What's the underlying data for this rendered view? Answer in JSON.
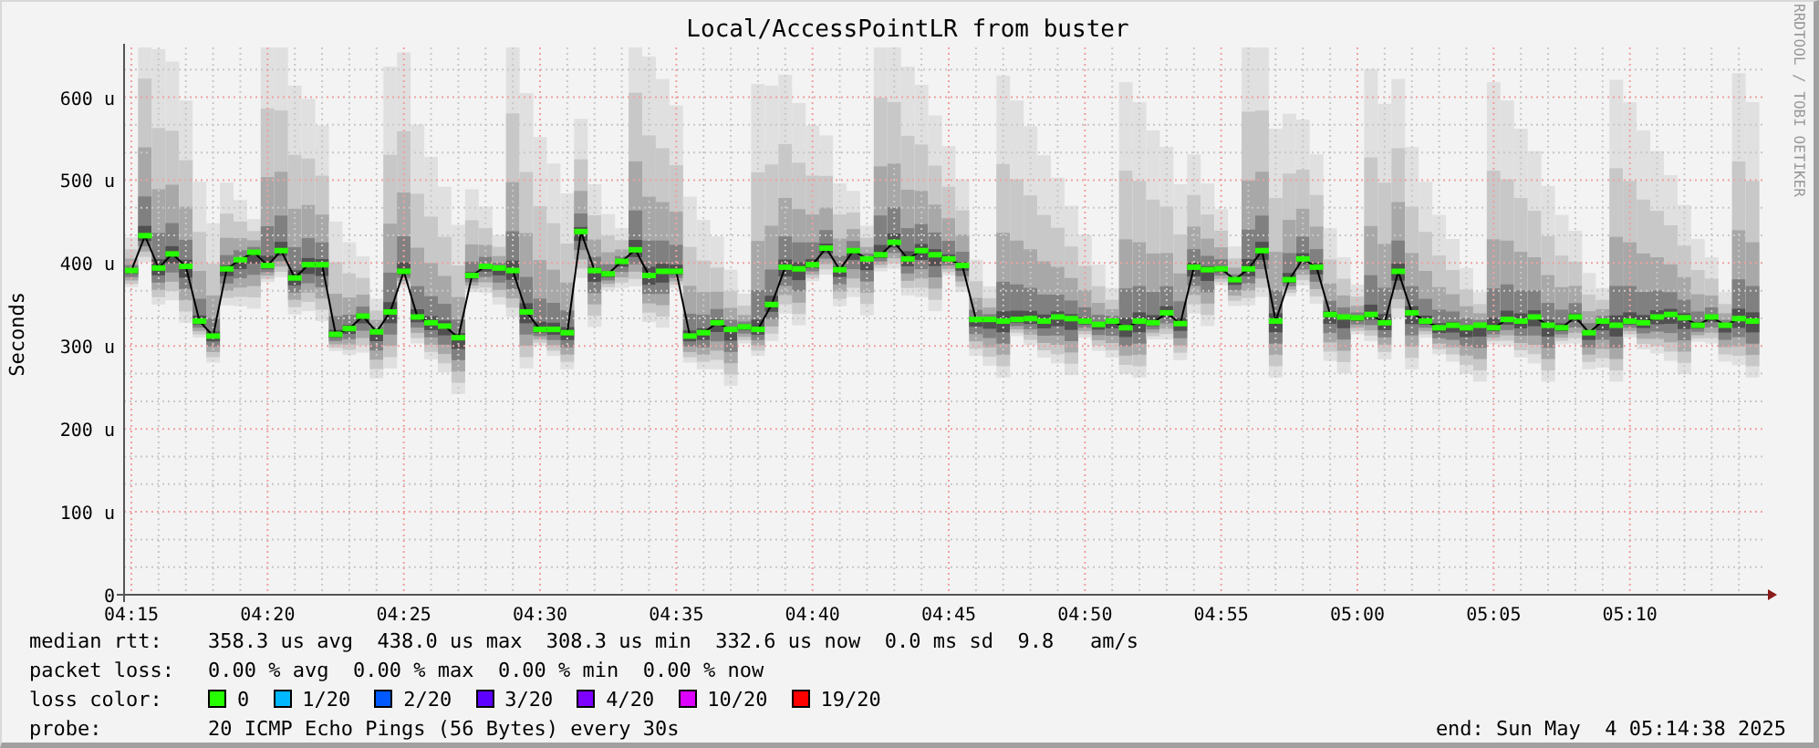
{
  "graph": {
    "title": "Local/AccessPointLR from buster",
    "credit": "RRDTOOL / TOBI OETIKER",
    "chart_data": {
      "type": "line",
      "grid": true,
      "ylabel": "Seconds",
      "ylim": [
        0,
        660
      ],
      "categories": [
        "04:15",
        null,
        null,
        null,
        null,
        null,
        null,
        null,
        null,
        null,
        "04:20",
        null,
        null,
        null,
        null,
        null,
        null,
        null,
        null,
        null,
        "04:25",
        null,
        null,
        null,
        null,
        null,
        null,
        null,
        null,
        null,
        "04:30",
        null,
        null,
        null,
        null,
        null,
        null,
        null,
        null,
        null,
        "04:35",
        null,
        null,
        null,
        null,
        null,
        null,
        null,
        null,
        null,
        "04:40",
        null,
        null,
        null,
        null,
        null,
        null,
        null,
        null,
        null,
        "04:45",
        null,
        null,
        null,
        null,
        null,
        null,
        null,
        null,
        null,
        "04:50",
        null,
        null,
        null,
        null,
        null,
        null,
        null,
        null,
        null,
        "04:55",
        null,
        null,
        null,
        null,
        null,
        null,
        null,
        null,
        null,
        "05:00",
        null,
        null,
        null,
        null,
        null,
        null,
        null,
        null,
        null,
        "05:05",
        null,
        null,
        null,
        null,
        null,
        null,
        null,
        null,
        null,
        "05:10",
        null,
        null,
        null,
        null,
        null,
        null,
        null,
        null,
        null
      ],
      "yticks": [
        {
          "value": 0,
          "label": "0"
        },
        {
          "value": 100,
          "label": "100 u"
        },
        {
          "value": 200,
          "label": "200 u"
        },
        {
          "value": 300,
          "label": "300 u"
        },
        {
          "value": 400,
          "label": "400 u"
        },
        {
          "value": 500,
          "label": "500 u"
        },
        {
          "value": 600,
          "label": "600 u"
        }
      ],
      "series": [
        {
          "name": "median rtt:",
          "color": "#26ff00",
          "marker": "square",
          "values": [
            391,
            433,
            394,
            411,
            396,
            330,
            312,
            393,
            404,
            413,
            397,
            415,
            382,
            398,
            398,
            314,
            321,
            336,
            317,
            341,
            390,
            335,
            328,
            324,
            310,
            385,
            396,
            394,
            391,
            341,
            320,
            320,
            316,
            438,
            391,
            387,
            402,
            416,
            385,
            390,
            390,
            312,
            316,
            328,
            320,
            323,
            320,
            350,
            395,
            393,
            398,
            418,
            392,
            415,
            405,
            410,
            425,
            405,
            415,
            410,
            405,
            397,
            332,
            332,
            330,
            332,
            333,
            330,
            335,
            333,
            330,
            326,
            330,
            322,
            330,
            328,
            340,
            327,
            395,
            392,
            393,
            380,
            393,
            415,
            330,
            380,
            405,
            395,
            338,
            335,
            334,
            338,
            328,
            390,
            340,
            330,
            322,
            325,
            322,
            325,
            322,
            332,
            330,
            335,
            325,
            322,
            335,
            316,
            330,
            325,
            330,
            328,
            335,
            338,
            334,
            325,
            335,
            325,
            333,
            330
          ]
        }
      ]
    }
  },
  "legend": {
    "median": {
      "text": "358.3 us avg  438.0 us max  308.3 us min  332.6 us now  0.0 ms sd  9.8   am/s"
    },
    "packet_loss": {
      "label": "packet loss:",
      "text": "0.00 % avg  0.00 % max  0.00 % min  0.00 % now"
    },
    "loss_color": {
      "label": "loss color:",
      "items": [
        {
          "label": "0",
          "color": "#26ff00"
        },
        {
          "label": "1/20",
          "color": "#00b8ff"
        },
        {
          "label": "2/20",
          "color": "#0059ff"
        },
        {
          "label": "3/20",
          "color": "#5e00ff"
        },
        {
          "label": "4/20",
          "color": "#7e00ff"
        },
        {
          "label": "10/20",
          "color": "#dd00ff"
        },
        {
          "label": "19/20",
          "color": "#ff0000"
        }
      ]
    },
    "probe": {
      "label": "probe:",
      "text": "20 ICMP Echo Pings (56 Bytes) every 30s"
    },
    "end": "end: Sun May  4 05:14:38 2025"
  }
}
